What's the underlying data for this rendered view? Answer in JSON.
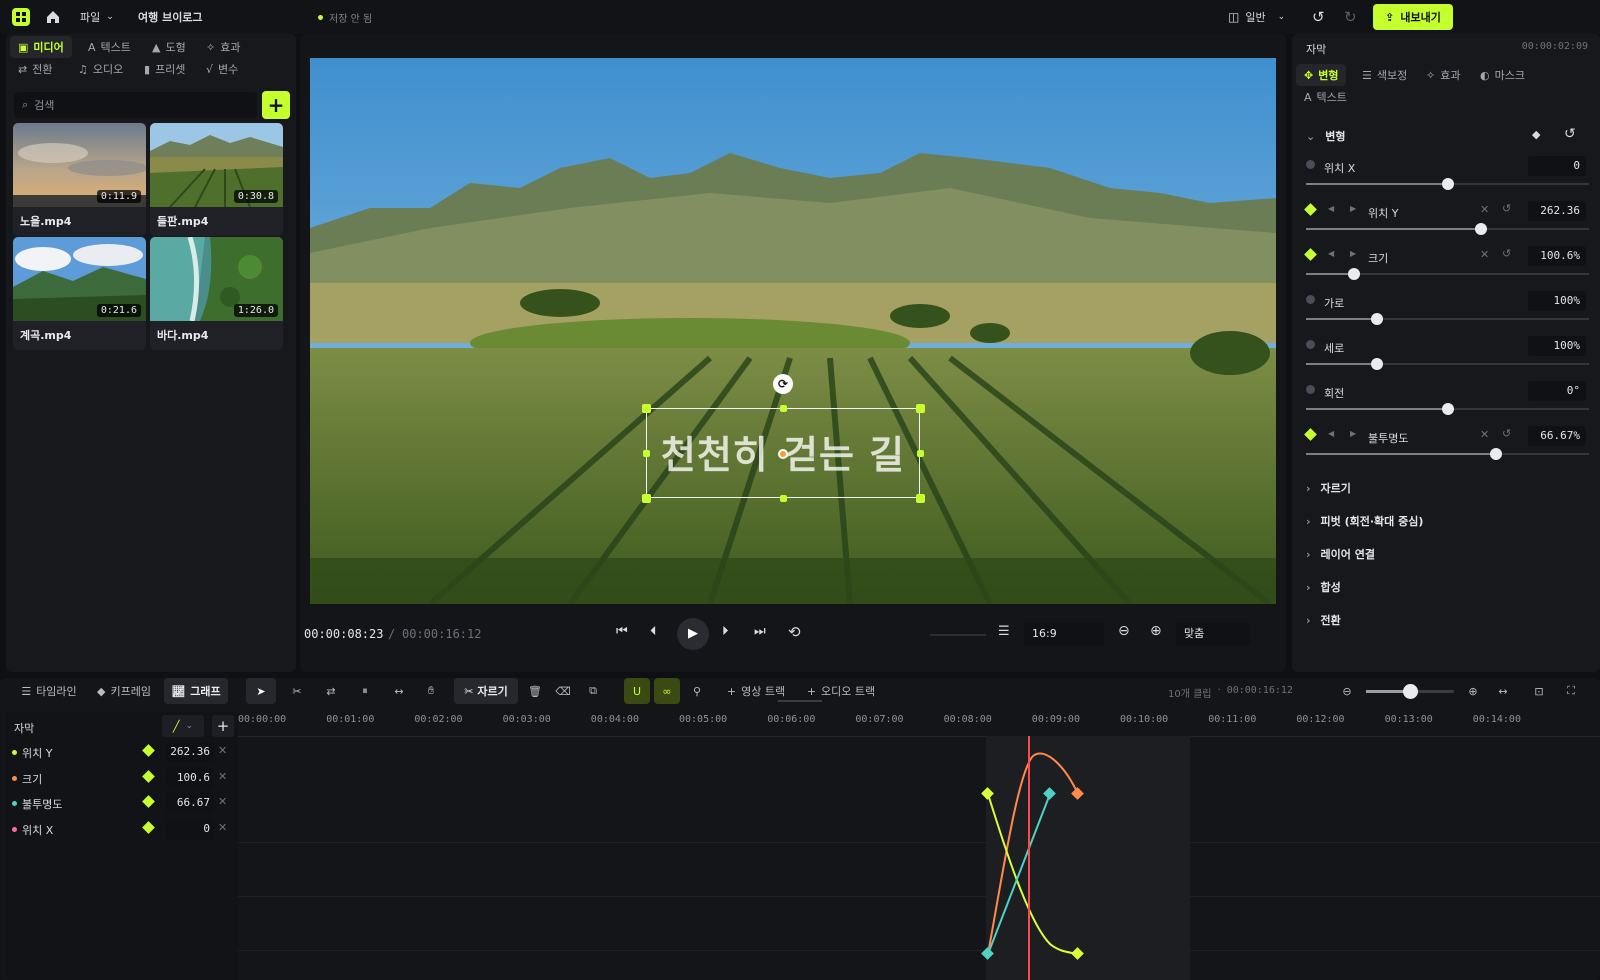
{
  "topbar": {
    "file_menu": "파일",
    "project_name": "여행 브이로그",
    "save_status": "저장 안 됨",
    "layout_mode": "일반",
    "export_label": "내보내기"
  },
  "left_panel": {
    "tabs": [
      {
        "label": "미디어",
        "icon": "media-icon"
      },
      {
        "label": "텍스트",
        "icon": "text-icon"
      },
      {
        "label": "도형",
        "icon": "shape-icon"
      },
      {
        "label": "효과",
        "icon": "effect-icon"
      },
      {
        "label": "전환",
        "icon": "transition-icon"
      },
      {
        "label": "오디오",
        "icon": "music-icon"
      },
      {
        "label": "프리셋",
        "icon": "bookmark-icon"
      },
      {
        "label": "변수",
        "icon": "variable-icon"
      }
    ],
    "search_placeholder": "검색",
    "media": [
      {
        "name": "노을.mp4",
        "duration": "0:11.9"
      },
      {
        "name": "들판.mp4",
        "duration": "0:30.8"
      },
      {
        "name": "계곡.mp4",
        "duration": "0:21.6"
      },
      {
        "name": "바다.mp4",
        "duration": "1:26.0"
      }
    ]
  },
  "preview": {
    "overlay_text": "천천히 걷는 길",
    "current_time": "00:00:08:23",
    "separator": "/",
    "total_time": "00:00:16:12",
    "aspect_ratio": "16:9",
    "zoom_mode": "맞춤"
  },
  "inspector": {
    "title": "자막",
    "clip_time": "00:00:02:09",
    "tabs": [
      {
        "label": "변형",
        "icon": "transform-icon"
      },
      {
        "label": "색보정",
        "icon": "color-icon"
      },
      {
        "label": "효과",
        "icon": "effect-icon"
      },
      {
        "label": "마스크",
        "icon": "mask-icon"
      },
      {
        "label": "텍스트",
        "icon": "text-icon"
      }
    ],
    "transform_section": "변형",
    "properties": [
      {
        "label": "위치 X",
        "value": "0",
        "keyframed": false,
        "level": 0.5
      },
      {
        "label": "위치 Y",
        "value": "262.36",
        "keyframed": true,
        "level": 0.62
      },
      {
        "label": "크기",
        "value": "100.6%",
        "keyframed": true,
        "level": 0.17
      },
      {
        "label": "가로",
        "value": "100%",
        "keyframed": false,
        "level": 0.25
      },
      {
        "label": "세로",
        "value": "100%",
        "keyframed": false,
        "level": 0.25
      },
      {
        "label": "회전",
        "value": "0°",
        "keyframed": false,
        "level": 0.5
      },
      {
        "label": "불투명도",
        "value": "66.67%",
        "keyframed": true,
        "level": 0.67
      }
    ],
    "sections": [
      "자르기",
      "피벗 (회전·확대 중심)",
      "레이어 연결",
      "합성",
      "전환"
    ]
  },
  "timeline": {
    "view_tabs": [
      "타임라인",
      "키프레임",
      "그래프"
    ],
    "cut_label": "자르기",
    "add_video_track": "영상 트랙",
    "add_audio_track": "오디오 트랙",
    "clip_count": "10개 클립",
    "separator": "·",
    "duration": "00:00:16:12",
    "track_header": "자막",
    "ruler": [
      "00:00:00",
      "00:01:00",
      "00:02:00",
      "00:03:00",
      "00:04:00",
      "00:05:00",
      "00:06:00",
      "00:07:00",
      "00:08:00",
      "00:09:00",
      "00:10:00",
      "00:11:00",
      "00:12:00",
      "00:13:00",
      "00:14:00"
    ],
    "tracks": [
      {
        "label": "위치 Y",
        "value": "262.36",
        "color": "#c6ff2e"
      },
      {
        "label": "크기",
        "value": "100.6",
        "color": "#ff8a4c"
      },
      {
        "label": "불투명도",
        "value": "66.67",
        "color": "#4fd1c5"
      },
      {
        "label": "위치 X",
        "value": "0",
        "color": "#ff6b9a"
      }
    ]
  },
  "colors": {
    "accent": "#c6ff2e",
    "playhead": "#ff4a4a",
    "curve_size": "#ff8a4c",
    "curve_position": "#d9ff3a",
    "curve_opacity": "#4fd1c5"
  }
}
